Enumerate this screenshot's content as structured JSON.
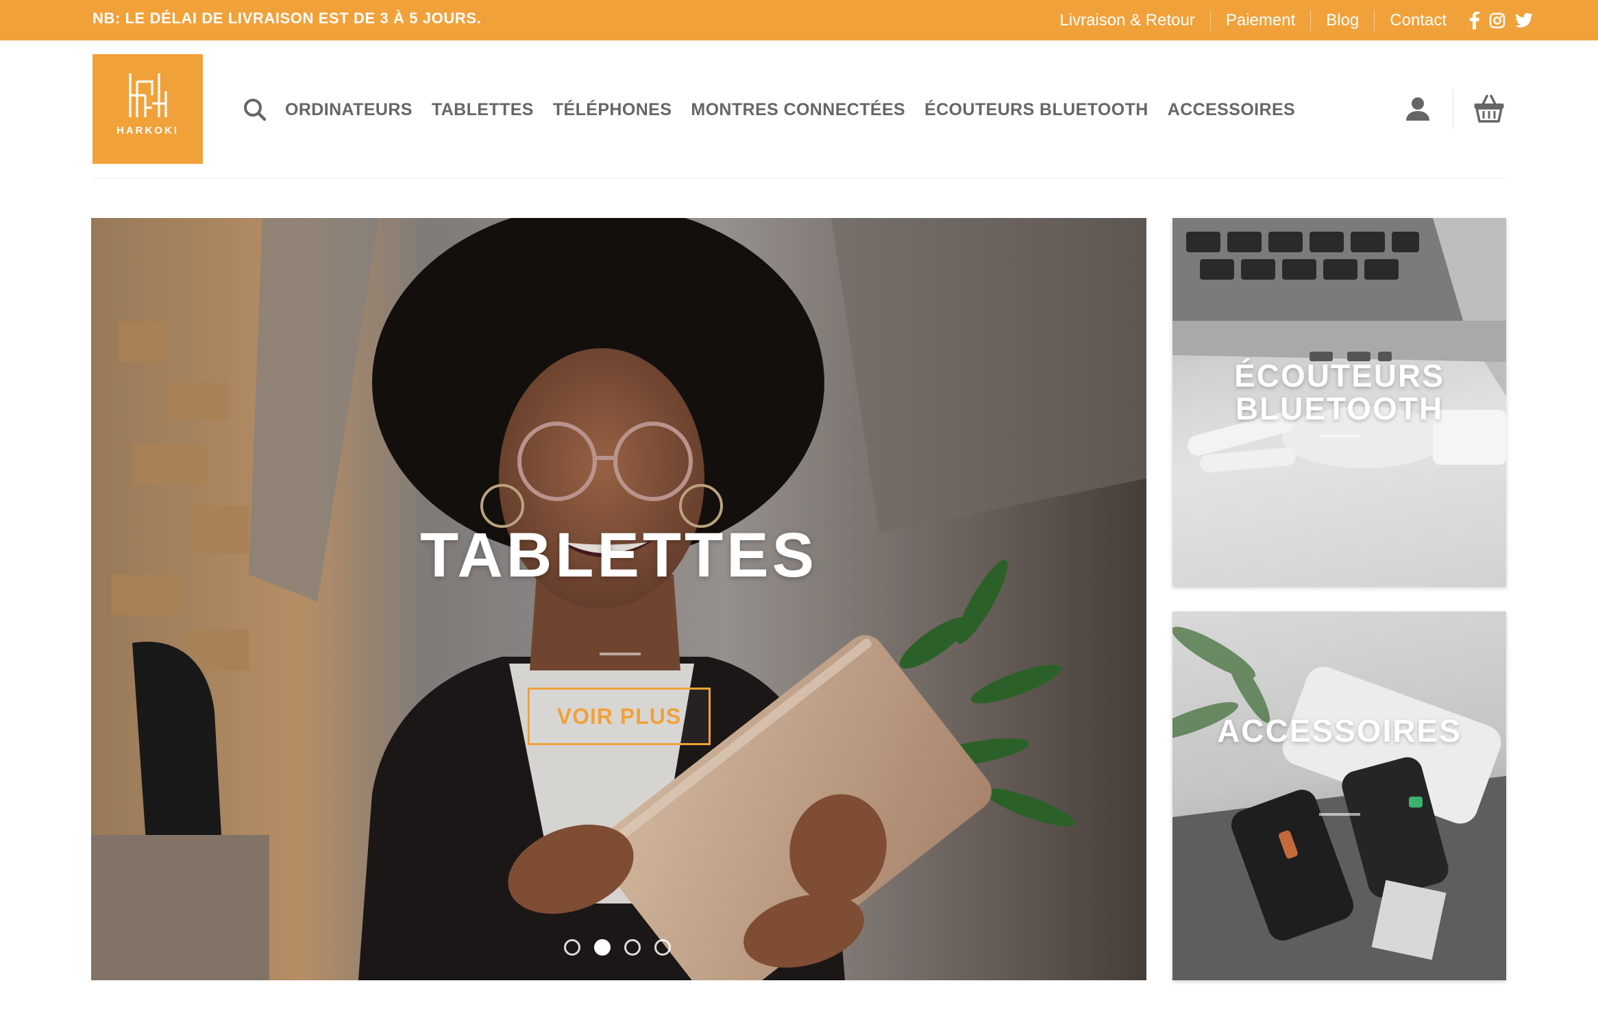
{
  "topbar": {
    "notice": "NB: LE DÉLAI DE LIVRAISON EST DE 3 À 5 JOURS.",
    "links": [
      "Livraison & Retour",
      "Paiement",
      "Blog",
      "Contact"
    ],
    "social_icons": [
      "facebook-icon",
      "instagram-icon",
      "twitter-icon"
    ],
    "color": "#f1a13a"
  },
  "header": {
    "logo_text": "HARKOKI",
    "nav": [
      "ORDINATEURS",
      "TABLETTES",
      "TÉLÉPHONES",
      "MONTRES CONNECTÉES",
      "ÉCOUTEURS BLUETOOTH",
      "ACCESSOIRES"
    ],
    "icons": [
      "search-icon",
      "user-icon",
      "cart-icon"
    ]
  },
  "slider": {
    "title": "TABLETTES",
    "button": "VOIR PLUS",
    "slides_count": 4,
    "active_slide": 2
  },
  "tiles": [
    {
      "title_line1": "ÉCOUTEURS",
      "title_line2": "BLUETOOTH"
    },
    {
      "title_line1": "ACCESSOIRES"
    }
  ],
  "accent_color": "#f1a13a"
}
